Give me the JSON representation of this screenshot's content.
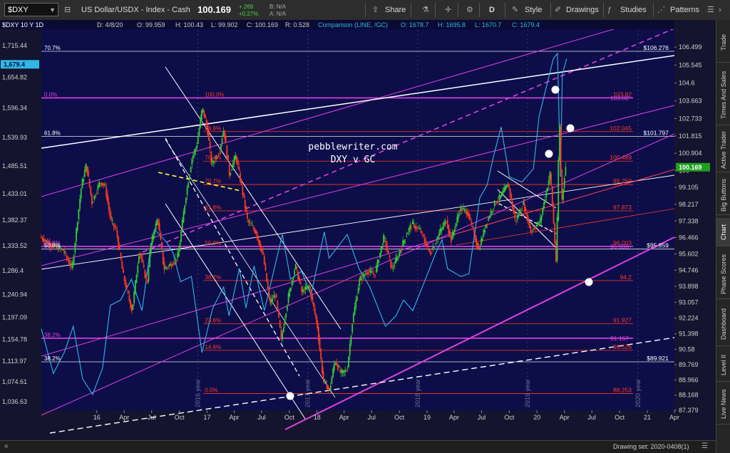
{
  "toolbar": {
    "symbol": "$DXY",
    "description": "US Dollar/USDX - Index - Cash",
    "last": "100.169",
    "change": "+.269",
    "change_pct": "+0.27%",
    "bid": "B: N/A",
    "ask": "A: N/A",
    "share": "Share",
    "aggregation": "D",
    "style": "Style",
    "drawings": "Drawings",
    "studies": "Studies",
    "patterns": "Patterns"
  },
  "side_tabs": [
    "Trade",
    "Times And Sales",
    "Active Trader",
    "Big Buttons",
    "Chart",
    "Phase Scores",
    "Dashboard",
    "Level II",
    "Live News"
  ],
  "footer": {
    "drawing_set": "Drawing set: 2020-0408(1)"
  },
  "colors": {
    "background": "#0d0d4a",
    "up": "#33cc33",
    "down": "#ff3b1f",
    "comparison": "#2fb8e6",
    "fib": "#ff3b1f",
    "magenta": "#e040e0",
    "white": "#ffffff"
  },
  "chart_data": {
    "type": "candlestick",
    "header": {
      "symbol_period": "$DXY 10 Y 1D",
      "date": "D: 4/8/20",
      "open": "O: 99.959",
      "high": "H: 100.43",
      "low": "L: 99.902",
      "close": "C: 100.169",
      "range": "R: 0.528",
      "comparison": "Comparison (LINE, /GC)",
      "comp_open": "O: 1678.7",
      "comp_high": "H: 1695.8",
      "comp_low": "L: 1670.7",
      "comp_close": "C: 1679.4"
    },
    "watermark": [
      "pebblewriter.com",
      "DXY v GC"
    ],
    "x_axis": {
      "range": [
        "2015-07-01",
        "2021-04-01"
      ],
      "ticks": [
        {
          "date": "2016-01-01",
          "label": "16"
        },
        {
          "date": "2016-04-01",
          "label": "Apr"
        },
        {
          "date": "2016-07-01",
          "label": "Jul"
        },
        {
          "date": "2016-10-01",
          "label": "Oct"
        },
        {
          "date": "2017-01-01",
          "label": "17"
        },
        {
          "date": "2017-04-01",
          "label": "Apr"
        },
        {
          "date": "2017-07-01",
          "label": "Jul"
        },
        {
          "date": "2017-10-01",
          "label": "Oct"
        },
        {
          "date": "2018-01-01",
          "label": "18"
        },
        {
          "date": "2018-04-01",
          "label": "Apr"
        },
        {
          "date": "2018-07-01",
          "label": "Jul"
        },
        {
          "date": "2018-10-01",
          "label": "Oct"
        },
        {
          "date": "2019-01-01",
          "label": "19"
        },
        {
          "date": "2019-04-01",
          "label": "Apr"
        },
        {
          "date": "2019-07-01",
          "label": "Jul"
        },
        {
          "date": "2019-10-01",
          "label": "Oct"
        },
        {
          "date": "2020-01-01",
          "label": "20"
        },
        {
          "date": "2020-04-01",
          "label": "Apr"
        },
        {
          "date": "2020-07-01",
          "label": "Jul"
        },
        {
          "date": "2020-10-01",
          "label": "Oct"
        },
        {
          "date": "2021-01-01",
          "label": "21"
        },
        {
          "date": "2021-04-01",
          "label": "Apr"
        }
      ],
      "year_markers": [
        {
          "date": "2016-12-01",
          "label": "2016 year"
        },
        {
          "date": "2017-12-01",
          "label": "2017 year"
        },
        {
          "date": "2018-12-01",
          "label": "2018 year"
        },
        {
          "date": "2019-12-01",
          "label": "2019 year"
        },
        {
          "date": "2020-12-01",
          "label": "2020 year"
        }
      ]
    },
    "y_axis_right": {
      "label": "DXY",
      "range": [
        87.37,
        107.4
      ],
      "ticks": [
        "106.499",
        "105.545",
        "104.6",
        "103.663",
        "102.733",
        "101.815",
        "100.904",
        "100",
        "99.105",
        "98.217",
        "97.338",
        "96.466",
        "95.602",
        "94.746",
        "93.898",
        "93.057",
        "92.224",
        "91.398",
        "90.58",
        "89.769",
        "88.966",
        "88.168",
        "87.379"
      ],
      "last_price": "100.169"
    },
    "y_axis_left": {
      "label": "/GC",
      "range": [
        1020,
        1745
      ],
      "ticks": [
        "1,715.44",
        "1,654.82",
        "1,596.34",
        "1,539.93",
        "1,485.51",
        "1,433.01",
        "1,382.37",
        "1,333.52",
        "1,286.4",
        "1,240.94",
        "1,197.09",
        "1,154.78",
        "1,113.97",
        "1,074.61",
        "1,036.63"
      ],
      "last_price": "1,679.4"
    },
    "dxy_path": [
      [
        "2015-07-01",
        96.5
      ],
      [
        "2015-08-15",
        96.0
      ],
      [
        "2015-09-15",
        95.8
      ],
      [
        "2015-10-15",
        94.8
      ],
      [
        "2015-11-01",
        97.3
      ],
      [
        "2015-11-15",
        99.2
      ],
      [
        "2015-12-01",
        100.3
      ],
      [
        "2015-12-20",
        98.3
      ],
      [
        "2016-01-15",
        99.4
      ],
      [
        "2016-02-01",
        99.2
      ],
      [
        "2016-02-20",
        97.4
      ],
      [
        "2016-03-10",
        96.8
      ],
      [
        "2016-04-01",
        94.5
      ],
      [
        "2016-05-01",
        92.6
      ],
      [
        "2016-05-25",
        95.8
      ],
      [
        "2016-06-20",
        94.0
      ],
      [
        "2016-07-01",
        96.0
      ],
      [
        "2016-07-25",
        97.5
      ],
      [
        "2016-08-15",
        94.8
      ],
      [
        "2016-09-10",
        95.1
      ],
      [
        "2016-10-01",
        95.5
      ],
      [
        "2016-10-25",
        98.5
      ],
      [
        "2016-11-15",
        100.6
      ],
      [
        "2016-12-01",
        101.3
      ],
      [
        "2016-12-20",
        103.3
      ],
      [
        "2017-01-05",
        102.3
      ],
      [
        "2017-01-20",
        100.3
      ],
      [
        "2017-02-15",
        101.0
      ],
      [
        "2017-03-01",
        102.2
      ],
      [
        "2017-03-20",
        99.8
      ],
      [
        "2017-04-10",
        100.8
      ],
      [
        "2017-05-01",
        99.0
      ],
      [
        "2017-05-20",
        97.3
      ],
      [
        "2017-06-15",
        96.8
      ],
      [
        "2017-07-10",
        95.5
      ],
      [
        "2017-08-01",
        93.0
      ],
      [
        "2017-08-20",
        93.5
      ],
      [
        "2017-09-08",
        91.1
      ],
      [
        "2017-10-01",
        93.3
      ],
      [
        "2017-10-25",
        95.0
      ],
      [
        "2017-11-15",
        93.6
      ],
      [
        "2017-12-10",
        93.9
      ],
      [
        "2018-01-05",
        91.9
      ],
      [
        "2018-01-25",
        89.0
      ],
      [
        "2018-02-15",
        88.4
      ],
      [
        "2018-03-05",
        90.0
      ],
      [
        "2018-03-25",
        89.3
      ],
      [
        "2018-04-15",
        89.5
      ],
      [
        "2018-05-01",
        91.9
      ],
      [
        "2018-05-25",
        94.2
      ],
      [
        "2018-06-20",
        94.7
      ],
      [
        "2018-07-15",
        94.5
      ],
      [
        "2018-08-15",
        96.5
      ],
      [
        "2018-09-10",
        94.8
      ],
      [
        "2018-10-01",
        95.5
      ],
      [
        "2018-10-25",
        96.5
      ],
      [
        "2018-11-15",
        97.2
      ],
      [
        "2018-12-15",
        96.8
      ],
      [
        "2019-01-15",
        95.6
      ],
      [
        "2019-02-15",
        96.7
      ],
      [
        "2019-03-10",
        97.4
      ],
      [
        "2019-03-25",
        96.3
      ],
      [
        "2019-04-25",
        98.0
      ],
      [
        "2019-05-20",
        97.8
      ],
      [
        "2019-06-25",
        95.8
      ],
      [
        "2019-07-20",
        97.2
      ],
      [
        "2019-08-15",
        98.2
      ],
      [
        "2019-09-05",
        98.6
      ],
      [
        "2019-10-01",
        99.3
      ],
      [
        "2019-10-25",
        97.3
      ],
      [
        "2019-11-20",
        98.3
      ],
      [
        "2019-12-15",
        96.8
      ],
      [
        "2020-01-15",
        97.3
      ],
      [
        "2020-02-18",
        99.9
      ],
      [
        "2020-03-09",
        95.0
      ],
      [
        "2020-03-19",
        102.9
      ],
      [
        "2020-03-27",
        98.3
      ],
      [
        "2020-04-08",
        100.2
      ]
    ],
    "gc_path": [
      [
        "2015-07-01",
        1175
      ],
      [
        "2015-08-10",
        1090
      ],
      [
        "2015-09-15",
        1130
      ],
      [
        "2015-10-15",
        1180
      ],
      [
        "2015-11-15",
        1080
      ],
      [
        "2015-12-18",
        1050
      ],
      [
        "2016-01-20",
        1100
      ],
      [
        "2016-02-15",
        1220
      ],
      [
        "2016-03-20",
        1230
      ],
      [
        "2016-04-25",
        1270
      ],
      [
        "2016-05-30",
        1210
      ],
      [
        "2016-06-25",
        1320
      ],
      [
        "2016-07-10",
        1365
      ],
      [
        "2016-08-20",
        1340
      ],
      [
        "2016-09-10",
        1320
      ],
      [
        "2016-10-05",
        1265
      ],
      [
        "2016-11-10",
        1275
      ],
      [
        "2016-12-15",
        1130
      ],
      [
        "2017-01-20",
        1215
      ],
      [
        "2017-02-25",
        1255
      ],
      [
        "2017-03-15",
        1200
      ],
      [
        "2017-04-18",
        1290
      ],
      [
        "2017-05-10",
        1215
      ],
      [
        "2017-06-06",
        1295
      ],
      [
        "2017-07-10",
        1210
      ],
      [
        "2017-08-10",
        1285
      ],
      [
        "2017-09-08",
        1355
      ],
      [
        "2017-10-05",
        1270
      ],
      [
        "2017-11-10",
        1285
      ],
      [
        "2017-12-12",
        1240
      ],
      [
        "2018-01-25",
        1360
      ],
      [
        "2018-02-10",
        1310
      ],
      [
        "2018-04-11",
        1355
      ],
      [
        "2018-05-20",
        1290
      ],
      [
        "2018-06-25",
        1255
      ],
      [
        "2018-08-16",
        1180
      ],
      [
        "2018-09-20",
        1200
      ],
      [
        "2018-10-15",
        1230
      ],
      [
        "2018-11-15",
        1210
      ],
      [
        "2018-12-20",
        1260
      ],
      [
        "2019-01-30",
        1320
      ],
      [
        "2019-02-20",
        1345
      ],
      [
        "2019-03-10",
        1290
      ],
      [
        "2019-04-23",
        1275
      ],
      [
        "2019-05-20",
        1280
      ],
      [
        "2019-06-25",
        1425
      ],
      [
        "2019-07-20",
        1450
      ],
      [
        "2019-08-10",
        1505
      ],
      [
        "2019-09-04",
        1560
      ],
      [
        "2019-10-01",
        1465
      ],
      [
        "2019-11-12",
        1455
      ],
      [
        "2019-12-20",
        1480
      ],
      [
        "2020-01-08",
        1580
      ],
      [
        "2020-02-24",
        1690
      ],
      [
        "2020-03-09",
        1700
      ],
      [
        "2020-03-19",
        1465
      ],
      [
        "2020-03-25",
        1660
      ],
      [
        "2020-04-08",
        1690
      ]
    ],
    "fib_levels": [
      {
        "pct": "100.0%",
        "value": 103.82,
        "from": "2016-12-20",
        "price_label": "103.82"
      },
      {
        "pct": "88.6%",
        "value": 102.045,
        "from": "2016-12-20",
        "price_label": "102.045"
      },
      {
        "pct": "76.4%",
        "value": 100.489,
        "from": "2016-12-20",
        "price_label": "100.489"
      },
      {
        "pct": "70.7%",
        "value": 99.259,
        "from": "2016-12-20",
        "price_label": "99.259"
      },
      {
        "pct": "61.8%",
        "value": 97.873,
        "from": "2016-12-20",
        "price_label": "97.873"
      },
      {
        "pct": "50.0%",
        "value": 96.003,
        "from": "2016-12-20",
        "price_label": "96.003"
      },
      {
        "pct": "38.2%",
        "value": 94.2,
        "from": "2016-12-20",
        "price_label": "94.2"
      },
      {
        "pct": "23.6%",
        "value": 91.927,
        "from": "2016-12-20",
        "price_label": "91.927"
      },
      {
        "pct": "14.6%",
        "value": 90.526,
        "from": "2016-12-20",
        "price_label": "90.526"
      },
      {
        "pct": "0.0%",
        "value": 88.253,
        "from": "2016-12-20",
        "price_label": "88.253"
      }
    ],
    "magenta_levels": [
      {
        "pct": "0.0%",
        "value": 103.82,
        "price_label": "103.82"
      },
      {
        "pct": "23.6%",
        "value": 96.0,
        "price_label": "96.036"
      },
      {
        "pct": "38.2%",
        "value": 91.167,
        "price_label": "91.167"
      }
    ],
    "white_levels": [
      {
        "pct": "70.7%",
        "value": 106.276,
        "price_label": "$106.276"
      },
      {
        "pct": "61.8%",
        "value": 101.797,
        "price_label": "$101.797"
      },
      {
        "pct": "50.0%",
        "value": 95.859,
        "price_label": "$95.859"
      },
      {
        "pct": "38.2%",
        "value": 89.921,
        "price_label": "$89.921"
      }
    ]
  }
}
